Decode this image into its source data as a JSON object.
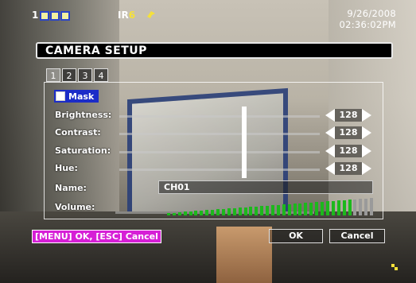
{
  "status_bar": {
    "camera_number": "1",
    "ir_label": "IR",
    "ir_value": "6",
    "date": "9/26/2008",
    "time": "02:36:02PM"
  },
  "title": "CAMERA SETUP",
  "tabs": [
    "1",
    "2",
    "3",
    "4"
  ],
  "active_tab": "1",
  "mask": {
    "label": "Mask",
    "checked": false
  },
  "settings": {
    "brightness": {
      "label": "Brightness:",
      "value": "128"
    },
    "contrast": {
      "label": "Contrast:",
      "value": "128"
    },
    "saturation": {
      "label": "Saturation:",
      "value": "128"
    },
    "hue": {
      "label": "Hue:",
      "value": "128"
    }
  },
  "name": {
    "label": "Name:",
    "value": "CH01"
  },
  "volume": {
    "label": "Volume:",
    "level_fraction": 0.9
  },
  "footer": {
    "hint": "[MENU] OK, [ESC] Cancel",
    "ok_label": "OK",
    "cancel_label": "Cancel"
  },
  "colors": {
    "mask_highlight": "#1b2cc8",
    "hint_background": "#d61fd6",
    "volume_bar": "#1cb81c",
    "ir_value": "#f5e13a"
  }
}
